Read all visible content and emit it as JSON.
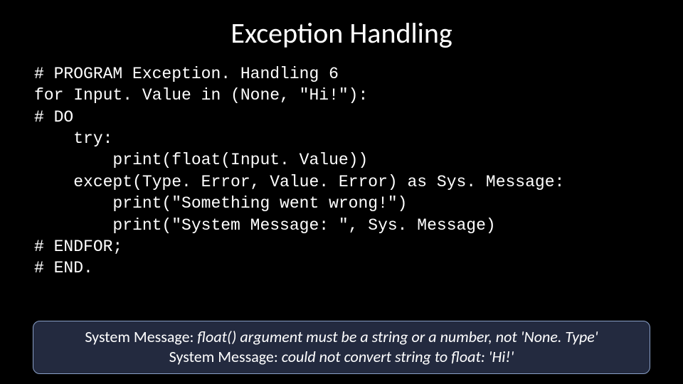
{
  "title": "Exception Handling",
  "code": {
    "l1": "# PROGRAM Exception. Handling 6",
    "l2": "for Input. Value in (None, \"Hi!\"):",
    "l3": "# DO",
    "l4": "    try:",
    "l5": "        print(float(Input. Value))",
    "l6": "    except(Type. Error, Value. Error) as Sys. Message:",
    "l7": "        print(\"Something went wrong!\")",
    "l8": "        print(\"System Message: \", Sys. Message)",
    "l9": "",
    "l10": "# ENDFOR;",
    "l11": "# END."
  },
  "output": {
    "line1_label": "System Message: ",
    "line1_msg": "float() argument must be a string or a number, not 'None. Type'",
    "line2_label": "System Message: ",
    "line2_msg": "could not convert string to float: 'Hi!'"
  }
}
